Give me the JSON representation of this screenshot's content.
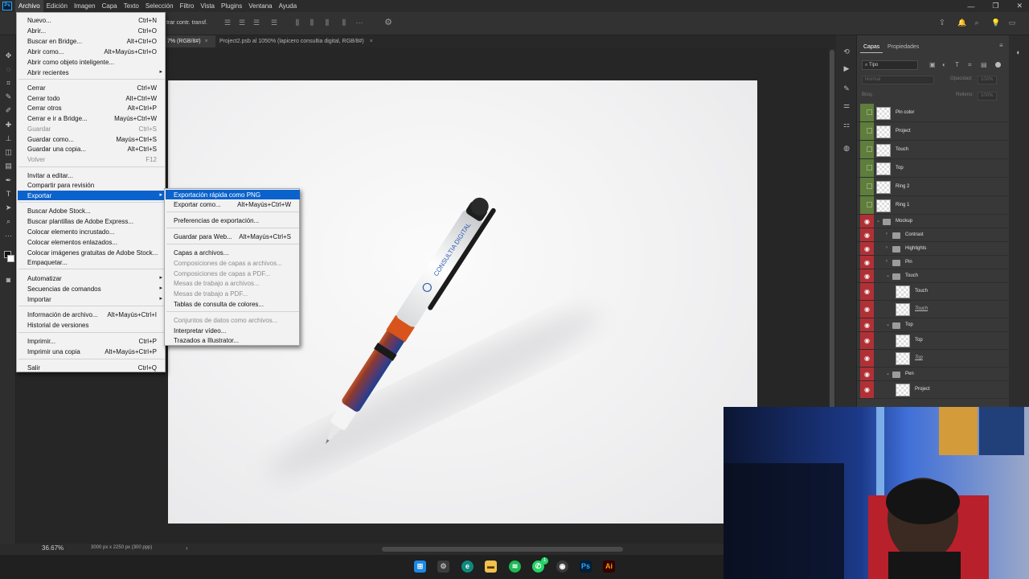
{
  "menubar": {
    "app_icon": "Ps",
    "items": [
      "Archivo",
      "Edición",
      "Imagen",
      "Capa",
      "Texto",
      "Selección",
      "Filtro",
      "Vista",
      "Plugins",
      "Ventana",
      "Ayuda"
    ]
  },
  "options_bar": {
    "label": "trar contr. transf."
  },
  "tabs": [
    {
      "label": "7% (RGB/8#)"
    },
    {
      "label": "Project2.psb al 1050% (lapicero consultia digital, RGB/8#)"
    }
  ],
  "file_menu": {
    "items": [
      {
        "label": "Nuevo...",
        "shortcut": "Ctrl+N"
      },
      {
        "label": "Abrir...",
        "shortcut": "Ctrl+O"
      },
      {
        "label": "Buscar en Bridge...",
        "shortcut": "Alt+Ctrl+O"
      },
      {
        "label": "Abrir como...",
        "shortcut": "Alt+Mayús+Ctrl+O"
      },
      {
        "label": "Abrir como objeto inteligente...",
        "shortcut": ""
      },
      {
        "label": "Abrir recientes",
        "shortcut": ""
      },
      {
        "label": "Cerrar",
        "shortcut": "Ctrl+W"
      },
      {
        "label": "Cerrar todo",
        "shortcut": "Alt+Ctrl+W"
      },
      {
        "label": "Cerrar otros",
        "shortcut": "Alt+Ctrl+P"
      },
      {
        "label": "Cerrar e ir a Bridge...",
        "shortcut": "Mayús+Ctrl+W"
      },
      {
        "label": "Guardar",
        "shortcut": "Ctrl+S"
      },
      {
        "label": "Guardar como...",
        "shortcut": "Mayús+Ctrl+S"
      },
      {
        "label": "Guardar una copia...",
        "shortcut": "Alt+Ctrl+S"
      },
      {
        "label": "Volver",
        "shortcut": "F12"
      },
      {
        "label": "Invitar a editar...",
        "shortcut": ""
      },
      {
        "label": "Compartir para revisión",
        "shortcut": ""
      },
      {
        "label": "Exportar",
        "shortcut": ""
      },
      {
        "label": "Buscar Adobe Stock...",
        "shortcut": ""
      },
      {
        "label": "Buscar plantillas de Adobe Express...",
        "shortcut": ""
      },
      {
        "label": "Colocar elemento incrustado...",
        "shortcut": ""
      },
      {
        "label": "Colocar elementos enlazados...",
        "shortcut": ""
      },
      {
        "label": "Colocar imágenes gratuitas de Adobe Stock...",
        "shortcut": ""
      },
      {
        "label": "Empaquetar...",
        "shortcut": ""
      },
      {
        "label": "Automatizar",
        "shortcut": ""
      },
      {
        "label": "Secuencias de comandos",
        "shortcut": ""
      },
      {
        "label": "Importar",
        "shortcut": ""
      },
      {
        "label": "Información de archivo...",
        "shortcut": "Alt+Mayús+Ctrl+I"
      },
      {
        "label": "Historial de versiones",
        "shortcut": ""
      },
      {
        "label": "Imprimir...",
        "shortcut": "Ctrl+P"
      },
      {
        "label": "Imprimir una copia",
        "shortcut": "Alt+Mayús+Ctrl+P"
      },
      {
        "label": "Salir",
        "shortcut": "Ctrl+Q"
      }
    ]
  },
  "export_menu": {
    "items": [
      {
        "label": "Exportación rápida como PNG",
        "shortcut": ""
      },
      {
        "label": "Exportar como...",
        "shortcut": "Alt+Mayús+Ctrl+W"
      },
      {
        "label": "Preferencias de exportación...",
        "shortcut": ""
      },
      {
        "label": "Guardar para Web...",
        "shortcut": "Alt+Mayús+Ctrl+S"
      },
      {
        "label": "Capas a archivos...",
        "shortcut": ""
      },
      {
        "label": "Composiciones de capas a archivos...",
        "shortcut": ""
      },
      {
        "label": "Composiciones de capas a PDF...",
        "shortcut": ""
      },
      {
        "label": "Mesas de trabajo a archivos...",
        "shortcut": ""
      },
      {
        "label": "Mesas de trabajo a PDF...",
        "shortcut": ""
      },
      {
        "label": "Tablas de consulta de colores...",
        "shortcut": ""
      },
      {
        "label": "Conjuntos de datos como archivos...",
        "shortcut": ""
      },
      {
        "label": "Interpretar vídeo...",
        "shortcut": ""
      },
      {
        "label": "Trazados a Illustrator...",
        "shortcut": ""
      }
    ]
  },
  "layers_panel": {
    "tabs": [
      "Capas",
      "Propiedades"
    ],
    "filter": "Tipo",
    "blend_mode": "Normal",
    "opacity_label": "Opacidad:",
    "opacity_value": "100%",
    "lock_label": "Bloq.:",
    "fill_label": "Relleno:",
    "fill_value": "100%",
    "layers": [
      {
        "name": "Pin color",
        "kind": "smart",
        "eye": "green"
      },
      {
        "name": "Project",
        "kind": "smart",
        "eye": "green"
      },
      {
        "name": "Touch",
        "kind": "smart",
        "eye": "green"
      },
      {
        "name": "Top",
        "kind": "smart",
        "eye": "green"
      },
      {
        "name": "Ring 2",
        "kind": "smart",
        "eye": "green"
      },
      {
        "name": "Ring 1",
        "kind": "smart",
        "eye": "green"
      },
      {
        "name": "Mockup",
        "kind": "folder-open",
        "eye": "red"
      },
      {
        "name": "Contrast",
        "kind": "folder",
        "eye": "red"
      },
      {
        "name": "Highlights",
        "kind": "folder",
        "eye": "red"
      },
      {
        "name": "Pin",
        "kind": "folder",
        "eye": "red"
      },
      {
        "name": "Touch",
        "kind": "folder-open",
        "eye": "red"
      },
      {
        "name": "Touch",
        "kind": "smart",
        "eye": "red"
      },
      {
        "name": "Touch",
        "kind": "mask",
        "eye": "red"
      },
      {
        "name": "Top",
        "kind": "folder-open",
        "eye": "red"
      },
      {
        "name": "Top",
        "kind": "smart",
        "eye": "red"
      },
      {
        "name": "Top",
        "kind": "mask",
        "eye": "red"
      },
      {
        "name": "Pen",
        "kind": "folder-open",
        "eye": "red"
      },
      {
        "name": "Project",
        "kind": "smart",
        "eye": "red"
      }
    ]
  },
  "document": {
    "pen_brand": "CONSULTIA DIGITAL"
  },
  "status": {
    "zoom": "36.67%",
    "doc_info": "3000 px x 2250 px (300 ppp)"
  },
  "taskbar": {
    "icons": [
      "windows-icon",
      "settings-icon",
      "edge-icon",
      "explorer-icon",
      "spotify-icon",
      "whatsapp-icon",
      "obs-icon",
      "photoshop-icon",
      "illustrator-icon"
    ],
    "whatsapp_badge": "1"
  },
  "colors": {
    "menu_highlight": "#0a62cc",
    "eye_green": "#5f7d3d",
    "eye_red": "#b13036"
  }
}
